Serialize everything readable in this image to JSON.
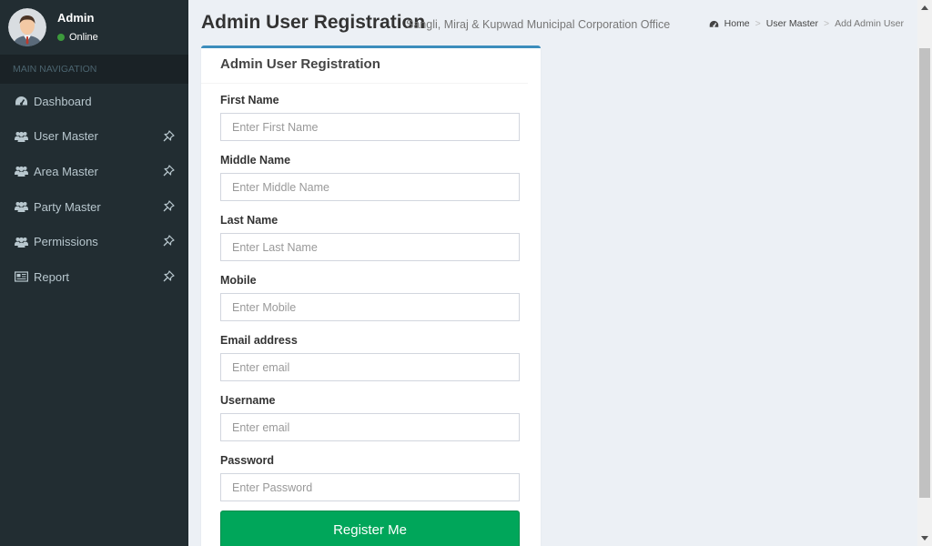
{
  "sidebar": {
    "user": {
      "name": "Admin",
      "status": "Online"
    },
    "header": "MAIN NAVIGATION",
    "items": [
      {
        "label": "Dashboard",
        "icon": "dashboard-icon"
      },
      {
        "label": "User Master",
        "icon": "users-icon"
      },
      {
        "label": "Area Master",
        "icon": "users-icon"
      },
      {
        "label": "Party Master",
        "icon": "users-icon"
      },
      {
        "label": "Permissions",
        "icon": "users-icon"
      },
      {
        "label": "Report",
        "icon": "newspaper-icon"
      }
    ]
  },
  "header": {
    "title": "Admin User Registration",
    "subtitle": "Sangli, Miraj & Kupwad Municipal Corporation Office",
    "breadcrumb": [
      "Home",
      "User Master",
      "Add Admin User"
    ]
  },
  "form": {
    "title": "Admin User Registration",
    "fields": [
      {
        "label": "First Name",
        "placeholder": "Enter First Name",
        "value": ""
      },
      {
        "label": "Middle Name",
        "placeholder": "Enter Middle Name",
        "value": ""
      },
      {
        "label": "Last Name",
        "placeholder": "Enter Last Name",
        "value": ""
      },
      {
        "label": "Mobile",
        "placeholder": "Enter Mobile",
        "value": ""
      },
      {
        "label": "Email address",
        "placeholder": "Enter email",
        "value": ""
      },
      {
        "label": "Username",
        "placeholder": "Enter email",
        "value": ""
      },
      {
        "label": "Password",
        "placeholder": "Enter Password",
        "value": ""
      }
    ],
    "submit_label": "Register Me"
  },
  "colors": {
    "sidebar_bg": "#222d32",
    "box_border": "#3c8dbc",
    "submit_bg": "#00a65a",
    "status_online": "#3c9a3c"
  }
}
